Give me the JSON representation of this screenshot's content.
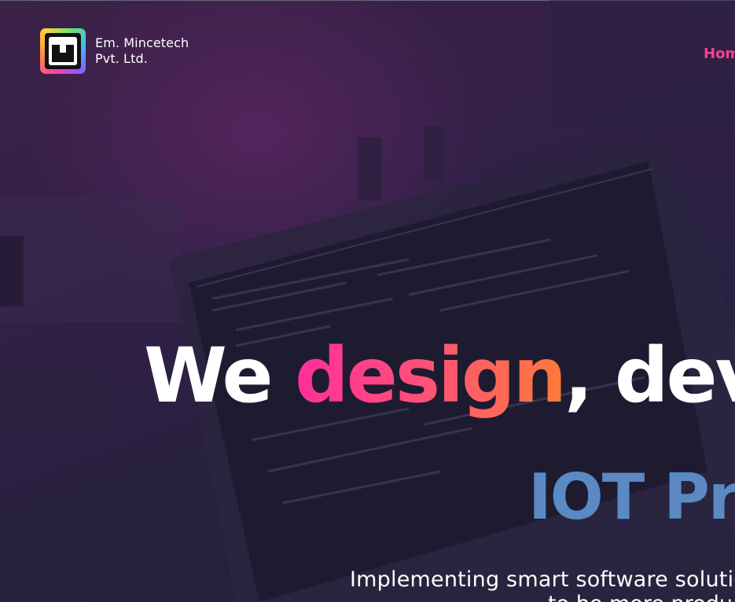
{
  "header": {
    "brand_line1": "Em. Mincetech",
    "brand_line2": "Pvt. Ltd.",
    "nav_home": "Hom"
  },
  "hero": {
    "title_start": "We ",
    "title_accent": "design",
    "title_end": ", dev",
    "subtitle": "IOT Pr",
    "tagline_line1": "Implementing smart software solutio",
    "tagline_line2": "to be more produ"
  },
  "colors": {
    "accent_pink": "#ff2f9b",
    "accent_orange": "#ff7a3a",
    "nav_active": "#ff3f8e",
    "subtitle_blue": "#5b89c4"
  },
  "icons": {
    "logo": "mincetech-logo-icon"
  }
}
